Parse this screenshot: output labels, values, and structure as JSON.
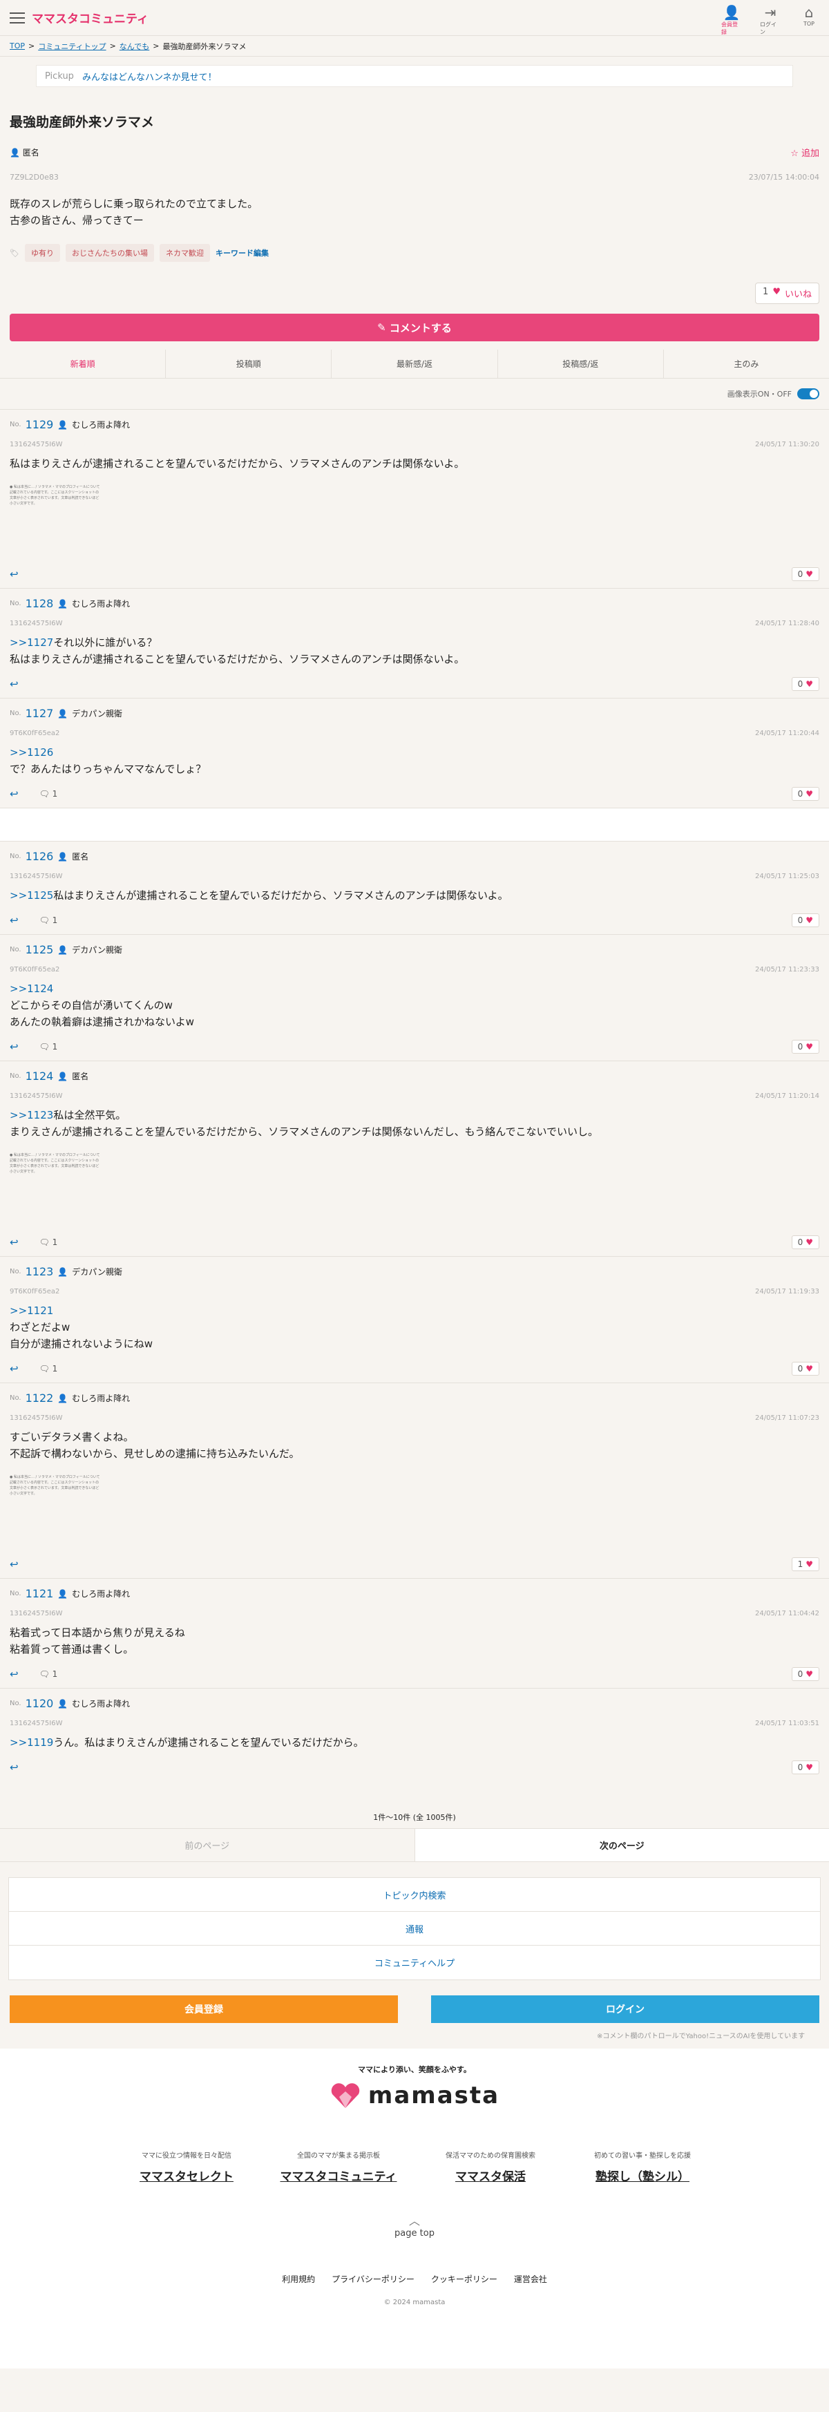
{
  "header": {
    "logo": "ママスタコミュニティ",
    "icons": [
      {
        "name": "user-icon",
        "label": "会員登録"
      },
      {
        "name": "login-icon",
        "label": "ログイン"
      },
      {
        "name": "home-icon",
        "label": "TOP"
      }
    ]
  },
  "breadcrumb": [
    "TOP",
    "コミュニティトップ",
    "なんでも",
    "最強助産師外来ソラマメ"
  ],
  "pickup": {
    "label": "Pickup",
    "text": "みんなはどんなハンネか見せて！"
  },
  "topic": {
    "title": "最強助産師外来ソラマメ",
    "author": "匿名",
    "add_label": "追加",
    "id": "7Z9L2D0e83",
    "date": "23/07/15 14:00:04",
    "body": [
      "既存のスレが荒らしに乗っ取られたので立てました。",
      "古参の皆さん、帰ってきてー"
    ],
    "tags": [
      "ゆ有り",
      "おじさんたちの集い場",
      "ネカマ歓迎"
    ],
    "tag_edit": "キーワード編集",
    "like_count": "1",
    "like_label": "いいね"
  },
  "comment_button": "コメントする",
  "sorts": [
    "新着順",
    "投稿順",
    "最新感/返",
    "投稿感/返",
    "主のみ"
  ],
  "image_toggle": "画像表示ON・OFF",
  "posts": [
    {
      "no": "No.",
      "num": "1129",
      "author": "むしろ雨よ降れ",
      "id": "131624575I6W",
      "date": "24/05/17 11:30:20",
      "ref": "",
      "lines": [
        "私はまりえさんが逮捕されることを望んでいるだけだから、ソラマメさんのアンチは関係ないよ。"
      ],
      "has_image": true,
      "image_text": "● 私は本当に… / ソラマメ・ママのプロフィールについて記載されている内容です。ここにはスクリーンショットの文章が小さく表示されています。文章は判読できないほど小さい文字です。",
      "replies": "",
      "likes": "0"
    },
    {
      "no": "No.",
      "num": "1128",
      "author": "むしろ雨よ降れ",
      "id": "131624575I6W",
      "date": "24/05/17 11:28:40",
      "ref": ">>1127",
      "lines": [
        "それ以外に誰がいる？",
        "私はまりえさんが逮捕されることを望んでいるだけだから、ソラマメさんのアンチは関係ないよ。"
      ],
      "has_image": false,
      "image_text": "",
      "replies": "",
      "likes": "0"
    },
    {
      "no": "No.",
      "num": "1127",
      "author": "デカパン親衛",
      "id": "9T6K0fF65ea2",
      "date": "24/05/17 11:20:44",
      "ref": ">>1126",
      "lines": [
        "",
        "で？あんたはりっちゃんママなんでしょ？"
      ],
      "has_image": false,
      "image_text": "",
      "replies": "1",
      "likes": "0"
    },
    {
      "no": "No.",
      "num": "1126",
      "author": "匿名",
      "id": "131624575I6W",
      "date": "24/05/17 11:25:03",
      "ref": ">>1125",
      "lines": [
        "私はまりえさんが逮捕されることを望んでいるだけだから、ソラマメさんのアンチは関係ないよ。"
      ],
      "has_image": false,
      "image_text": "",
      "replies": "1",
      "likes": "0"
    },
    {
      "no": "No.",
      "num": "1125",
      "author": "デカパン親衛",
      "id": "9T6K0fF65ea2",
      "date": "24/05/17 11:23:33",
      "ref": ">>1124",
      "lines": [
        "",
        "どこからその自信が湧いてくんのw",
        "あんたの執着癖は逮捕されかねないよw"
      ],
      "has_image": false,
      "image_text": "",
      "replies": "1",
      "likes": "0"
    },
    {
      "no": "No.",
      "num": "1124",
      "author": "匿名",
      "id": "131624575I6W",
      "date": "24/05/17 11:20:14",
      "ref": ">>1123",
      "lines": [
        "私は全然平気。",
        "まりえさんが逮捕されることを望んでいるだけだから、ソラマメさんのアンチは関係ないんだし、もう絡んでこないでいいし。"
      ],
      "has_image": true,
      "image_text": "● 私は本当に… / ソラマメ・ママのプロフィールについて記載されている内容です。ここにはスクリーンショットの文章が小さく表示されています。文章は判読できないほど小さい文字です。",
      "replies": "1",
      "likes": "0"
    },
    {
      "no": "No.",
      "num": "1123",
      "author": "デカパン親衛",
      "id": "9T6K0fF65ea2",
      "date": "24/05/17 11:19:33",
      "ref": ">>1121",
      "lines": [
        "",
        "わざとだよw",
        "自分が逮捕されないようにねw"
      ],
      "has_image": false,
      "image_text": "",
      "replies": "1",
      "likes": "0"
    },
    {
      "no": "No.",
      "num": "1122",
      "author": "むしろ雨よ降れ",
      "id": "131624575I6W",
      "date": "24/05/17 11:07:23",
      "ref": "",
      "lines": [
        "すごいデタラメ書くよね。",
        "不起訴で構わないから、見せしめの逮捕に持ち込みたいんだ。"
      ],
      "has_image": true,
      "image_text": "● 私は本当に… / ソラマメ・ママのプロフィールについて記載されている内容です。ここにはスクリーンショットの文章が小さく表示されています。文章は判読できないほど小さい文字です。",
      "replies": "",
      "likes": "1"
    },
    {
      "no": "No.",
      "num": "1121",
      "author": "むしろ雨よ降れ",
      "id": "131624575I6W",
      "date": "24/05/17 11:04:42",
      "ref": "",
      "lines": [
        "粘着式って日本語から焦りが見えるね",
        "粘着質って普通は書くし。"
      ],
      "has_image": false,
      "image_text": "",
      "replies": "1",
      "likes": "0"
    },
    {
      "no": "No.",
      "num": "1120",
      "author": "むしろ雨よ降れ",
      "id": "131624575I6W",
      "date": "24/05/17 11:03:51",
      "ref": ">>1119",
      "lines": [
        "うん。私はまりえさんが逮捕されることを望んでいるだけだから。"
      ],
      "has_image": false,
      "image_text": "",
      "replies": "",
      "likes": "0"
    }
  ],
  "pager": {
    "info": "1件〜10件 (全 1005件)",
    "prev": "前のページ",
    "next": "次のページ"
  },
  "links": [
    "トピック内検索",
    "通報",
    "コミュニティヘルプ"
  ],
  "auth": {
    "register": "会員登録",
    "login": "ログイン"
  },
  "footnote": "※コメント欄のパトロールでYahoo!ニュースのAIを使用しています",
  "footer": {
    "slogan": "ママにより添い、笑顔をふやす。",
    "logo_word": "mamasta",
    "brands": [
      {
        "sub": "ママに役立つ情報を日々配信",
        "name": "ママスタセレクト"
      },
      {
        "sub": "全国のママが集まる掲示板",
        "name": "ママスタコミュニティ"
      },
      {
        "sub": "保活ママのための保育園検索",
        "name": "ママスタ保活"
      },
      {
        "sub": "初めての習い事・塾探しを応援",
        "name": "塾探し（塾シル）"
      }
    ],
    "page_top": "page top",
    "links": [
      "利用規約",
      "プライバシーポリシー",
      "クッキーポリシー",
      "運営会社"
    ],
    "copyright": "© 2024 mamasta"
  },
  "colors": {
    "accent": "#e5316c",
    "link": "#0d6db2",
    "register": "#f7921e",
    "login": "#2ca6da"
  }
}
